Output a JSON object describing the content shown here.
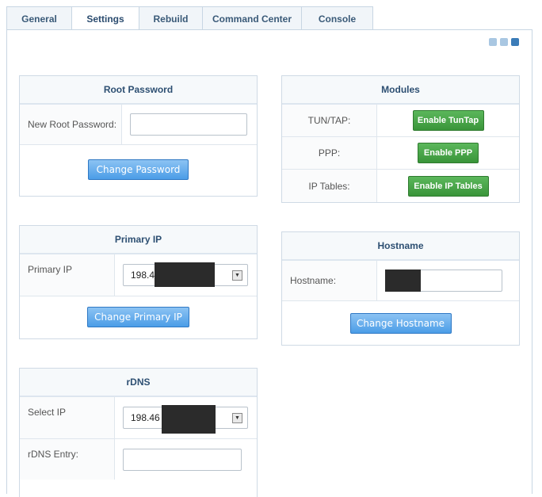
{
  "tabs": [
    {
      "label": "General",
      "active": false
    },
    {
      "label": "Settings",
      "active": true
    },
    {
      "label": "Rebuild",
      "active": false
    },
    {
      "label": "Command Center",
      "active": false
    },
    {
      "label": "Console",
      "active": false
    }
  ],
  "root_password": {
    "title": "Root Password",
    "field_label": "New Root Password:",
    "field_value": "",
    "button": "Change Password"
  },
  "primary_ip": {
    "title": "Primary IP",
    "field_label": "Primary IP",
    "selected_visible": "198.4",
    "button": "Change Primary IP"
  },
  "rdns": {
    "title": "rDNS",
    "select_label": "Select IP",
    "selected_visible": "198.46",
    "entry_label": "rDNS Entry:",
    "entry_value": ""
  },
  "modules": {
    "title": "Modules",
    "rows": [
      {
        "label": "TUN/TAP:",
        "button": "Enable TunTap"
      },
      {
        "label": "PPP:",
        "button": "Enable PPP"
      },
      {
        "label": "IP Tables:",
        "button": "Enable IP Tables"
      }
    ]
  },
  "hostname": {
    "title": "Hostname",
    "field_label": "Hostname:",
    "button": "Change Hostname"
  },
  "colors": {
    "accent_blue": "#4b9de7",
    "green": "#3a953a",
    "heading": "#2d4f72"
  }
}
